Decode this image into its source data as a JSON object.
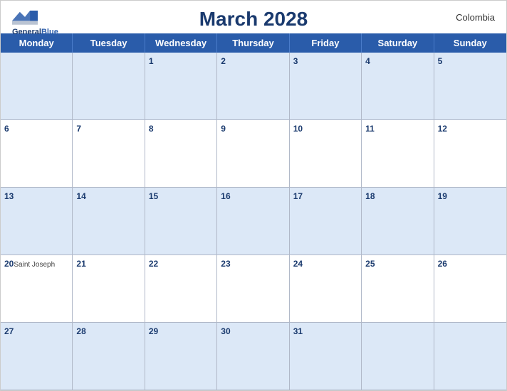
{
  "header": {
    "title": "March 2028",
    "country": "Colombia",
    "logo_general": "General",
    "logo_blue": "Blue"
  },
  "days": [
    "Monday",
    "Tuesday",
    "Wednesday",
    "Thursday",
    "Friday",
    "Saturday",
    "Sunday"
  ],
  "weeks": [
    {
      "shaded": true,
      "cells": [
        {
          "num": "",
          "event": ""
        },
        {
          "num": "",
          "event": ""
        },
        {
          "num": "1",
          "event": ""
        },
        {
          "num": "2",
          "event": ""
        },
        {
          "num": "3",
          "event": ""
        },
        {
          "num": "4",
          "event": ""
        },
        {
          "num": "5",
          "event": ""
        }
      ]
    },
    {
      "shaded": false,
      "cells": [
        {
          "num": "6",
          "event": ""
        },
        {
          "num": "7",
          "event": ""
        },
        {
          "num": "8",
          "event": ""
        },
        {
          "num": "9",
          "event": ""
        },
        {
          "num": "10",
          "event": ""
        },
        {
          "num": "11",
          "event": ""
        },
        {
          "num": "12",
          "event": ""
        }
      ]
    },
    {
      "shaded": true,
      "cells": [
        {
          "num": "13",
          "event": ""
        },
        {
          "num": "14",
          "event": ""
        },
        {
          "num": "15",
          "event": ""
        },
        {
          "num": "16",
          "event": ""
        },
        {
          "num": "17",
          "event": ""
        },
        {
          "num": "18",
          "event": ""
        },
        {
          "num": "19",
          "event": ""
        }
      ]
    },
    {
      "shaded": false,
      "cells": [
        {
          "num": "20",
          "event": "Saint Joseph"
        },
        {
          "num": "21",
          "event": ""
        },
        {
          "num": "22",
          "event": ""
        },
        {
          "num": "23",
          "event": ""
        },
        {
          "num": "24",
          "event": ""
        },
        {
          "num": "25",
          "event": ""
        },
        {
          "num": "26",
          "event": ""
        }
      ]
    },
    {
      "shaded": true,
      "cells": [
        {
          "num": "27",
          "event": ""
        },
        {
          "num": "28",
          "event": ""
        },
        {
          "num": "29",
          "event": ""
        },
        {
          "num": "30",
          "event": ""
        },
        {
          "num": "31",
          "event": ""
        },
        {
          "num": "",
          "event": ""
        },
        {
          "num": "",
          "event": ""
        }
      ]
    }
  ]
}
